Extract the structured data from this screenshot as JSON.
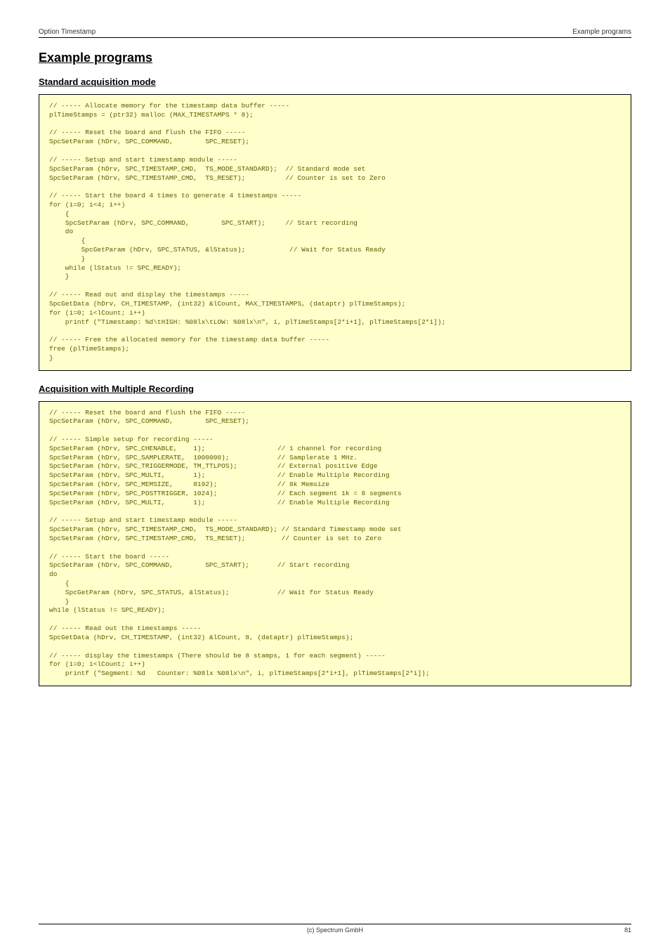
{
  "header": {
    "left": "Option Timestamp",
    "right": "Example programs"
  },
  "h1": "Example programs",
  "section1": {
    "title": "Standard acquisition mode",
    "code": "// ----- Allocate memory for the timestamp data buffer -----\nplTimeStamps = (ptr32) malloc (MAX_TIMESTAMPS * 8);\n\n// ----- Reset the board and flush the FIFO -----\nSpcSetParam (hDrv, SPC_COMMAND,        SPC_RESET);\n\n// ----- Setup and start timestamp module -----\nSpcSetParam (hDrv, SPC_TIMESTAMP_CMD,  TS_MODE_STANDARD);  // Standard mode set\nSpcSetParam (hDrv, SPC_TIMESTAMP_CMD,  TS_RESET);          // Counter is set to Zero\n\n// ----- Start the board 4 times to generate 4 timestamps -----\nfor (i=0; i<4; i++)\n    {\n    SpcSetParam (hDrv, SPC_COMMAND,        SPC_START);     // Start recording\n    do\n        {\n        SpcGetParam (hDrv, SPC_STATUS, &lStatus);           // Wait for Status Ready\n        }\n    while (lStatus != SPC_READY);\n    }\n\n// ----- Read out and display the timestamps -----\nSpcGetData (hDrv, CH_TIMESTAMP, (int32) &lCount, MAX_TIMESTAMPS, (dataptr) plTimeStamps);\nfor (i=0; i<lCount; i++)\n    printf (\"Timestamp: %d\\tHIGH: %08lx\\tLOW: %08lx\\n\", i, plTimeStamps[2*i+1], plTimeStamps[2*i]);\n\n// ----- Free the allocated memory for the timestamp data buffer -----\nfree (plTimeStamps);\n}"
  },
  "section2": {
    "title": "Acquisition with Multiple Recording",
    "code": "// ----- Reset the board and flush the FIFO -----\nSpcSetParam (hDrv, SPC_COMMAND,        SPC_RESET);\n\n// ----- Simple setup for recording -----\nSpcSetParam (hDrv, SPC_CHENABLE,    1);                  // 1 channel for recording\nSpcSetParam (hDrv, SPC_SAMPLERATE,  1000000);            // Samplerate 1 MHz.\nSpcSetParam (hDrv, SPC_TRIGGERMODE, TM_TTLPOS);          // External positive Edge\nSpcSetParam (hDrv, SPC_MULTI,       1);                  // Enable Multiple Recording\nSpcSetParam (hDrv, SPC_MEMSIZE,     8192);               // 8k Memsize\nSpcSetParam (hDrv, SPC_POSTTRIGGER, 1024);               // Each segment 1k = 8 segments\nSpcSetParam (hDrv, SPC_MULTI,       1);                  // Enable Multiple Recording\n\n// ----- Setup and start timestamp module -----\nSpcSetParam (hDrv, SPC_TIMESTAMP_CMD,  TS_MODE_STANDARD); // Standard Timestamp mode set\nSpcSetParam (hDrv, SPC_TIMESTAMP_CMD,  TS_RESET);         // Counter is set to Zero\n\n// ----- Start the board -----\nSpcSetParam (hDrv, SPC_COMMAND,        SPC_START);       // Start recording\ndo\n    {\n    SpcGetParam (hDrv, SPC_STATUS, &lStatus);            // Wait for Status Ready\n    }\nwhile (lStatus != SPC_READY);\n\n// ----- Read out the timestamps -----\nSpcGetData (hDrv, CH_TIMESTAMP, (int32) &lCount, 8, (dataptr) plTimeStamps);\n\n// ----- display the timestamps (There should be 8 stamps, 1 for each segment) -----\nfor (i=0; i<lCount; i++)\n    printf (\"Segment: %d   Counter: %08lx %08lx\\n\", i, plTimeStamps[2*i+1], plTimeStamps[2*i]);"
  },
  "footer": {
    "center": "(c) Spectrum GmbH",
    "right": "81"
  }
}
